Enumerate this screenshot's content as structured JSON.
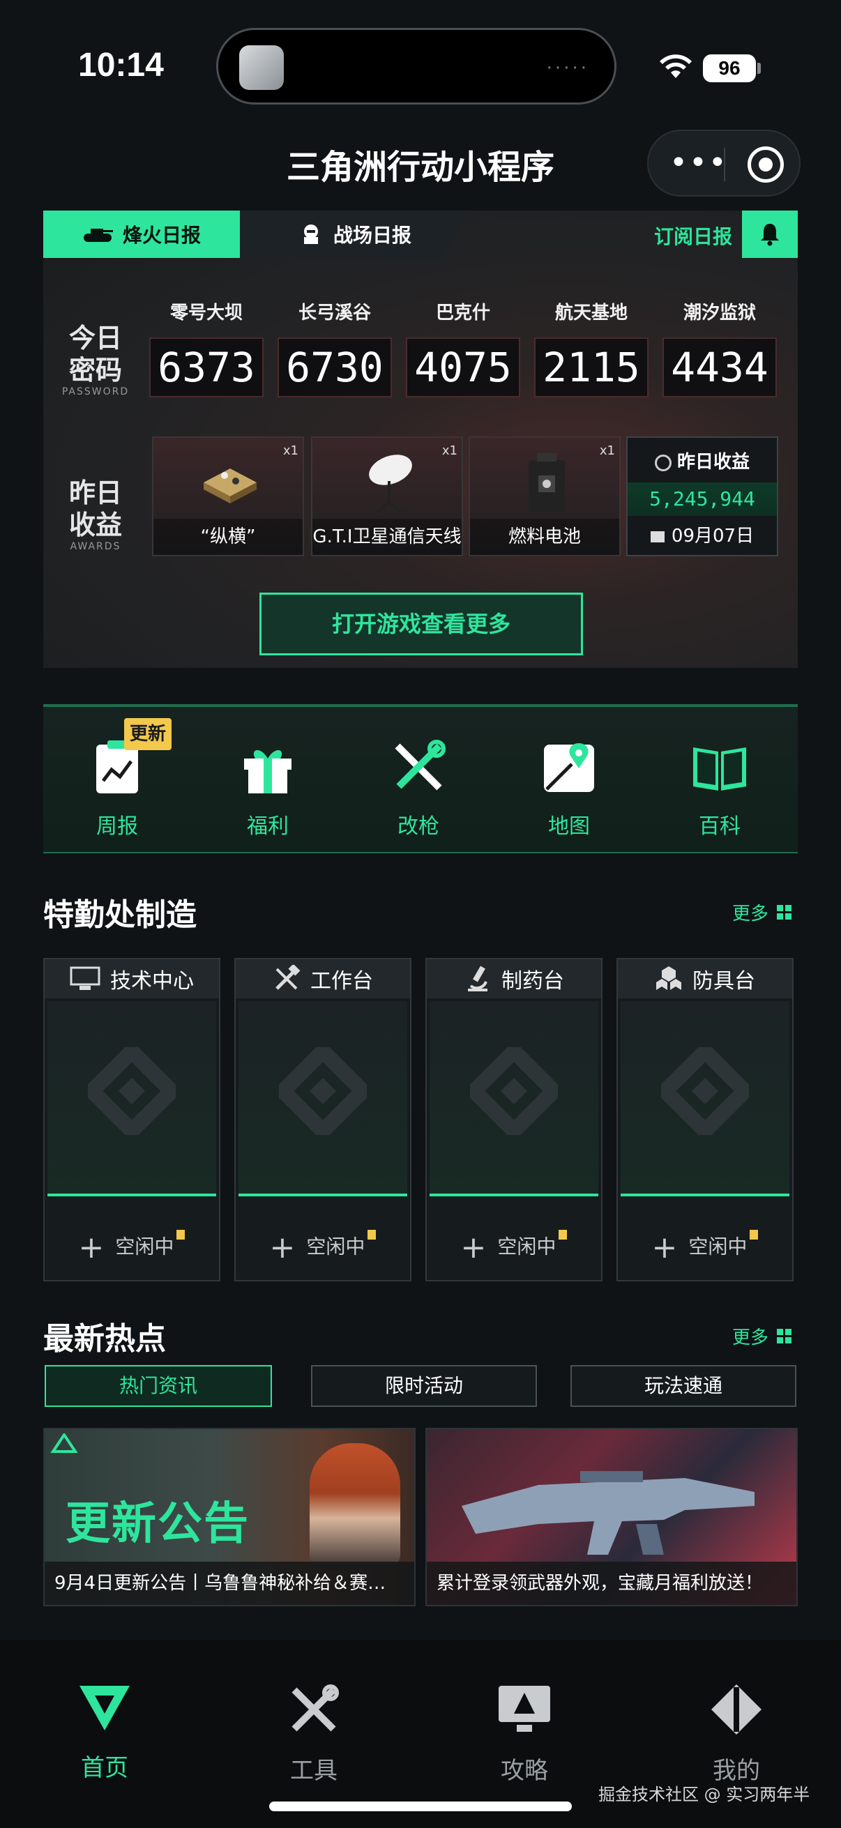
{
  "status": {
    "time": "10:14",
    "battery": "96",
    "activity_dots": "·····"
  },
  "titlebar": {
    "title": "三角洲行动小程序",
    "menu_glyph": "•••"
  },
  "daily": {
    "tab_active": "烽火日报",
    "tab_inactive": "战场日报",
    "subscribe": "订阅日报",
    "password_label": "今日\n密码",
    "password_sub": "PASSWORD",
    "awards_label": "昨日\n收益",
    "awards_sub": "AWARDS",
    "maps": [
      {
        "name": "零号大坝",
        "code": "6373"
      },
      {
        "name": "长弓溪谷",
        "code": "6730"
      },
      {
        "name": "巴克什",
        "code": "4075"
      },
      {
        "name": "航天基地",
        "code": "2115"
      },
      {
        "name": "潮汐监狱",
        "code": "4434"
      }
    ],
    "items": [
      {
        "name": "“纵横”",
        "count": "x1"
      },
      {
        "name": "G.T.I卫星通信天线",
        "count": "x1"
      },
      {
        "name": "燃料电池",
        "count": "x1"
      }
    ],
    "yesterday": {
      "title": "昨日收益",
      "value": "5,245,944",
      "date": "09月07日"
    },
    "open_game": "打开游戏查看更多"
  },
  "quick": {
    "new_badge": "更新",
    "items": [
      {
        "label": "周报",
        "icon": "report-icon"
      },
      {
        "label": "福利",
        "icon": "gift-icon"
      },
      {
        "label": "改枪",
        "icon": "gun-wrench-icon"
      },
      {
        "label": "地图",
        "icon": "map-pin-icon"
      },
      {
        "label": "百科",
        "icon": "book-icon"
      }
    ]
  },
  "craft": {
    "title": "特勤处制造",
    "more": "更多",
    "stations": [
      {
        "name": "技术中心",
        "status": "空闲中",
        "icon": "computer-icon"
      },
      {
        "name": "工作台",
        "status": "空闲中",
        "icon": "tools-icon"
      },
      {
        "name": "制药台",
        "status": "空闲中",
        "icon": "microscope-icon"
      },
      {
        "name": "防具台",
        "status": "空闲中",
        "icon": "armor-icon"
      }
    ]
  },
  "news": {
    "title": "最新热点",
    "more": "更多",
    "tabs": [
      "热门资讯",
      "限时活动",
      "玩法速通"
    ],
    "cards": [
      {
        "caption": "9月4日更新公告丨乌鲁鲁神秘补给＆赛…",
        "banner": "更新公告"
      },
      {
        "caption": "累计登录领武器外观，宝藏月福利放送！"
      }
    ]
  },
  "nav": {
    "items": [
      {
        "label": "首页",
        "icon": "delta-logo-icon"
      },
      {
        "label": "工具",
        "icon": "tools-cross-icon"
      },
      {
        "label": "攻略",
        "icon": "monitor-icon"
      },
      {
        "label": "我的",
        "icon": "profile-diamond-icon"
      }
    ],
    "watermark": "掘金技术社区 @ 实习两年半"
  },
  "colors": {
    "accent": "#2ee59d",
    "background": "#0f1316",
    "badge": "#f2c94c"
  }
}
